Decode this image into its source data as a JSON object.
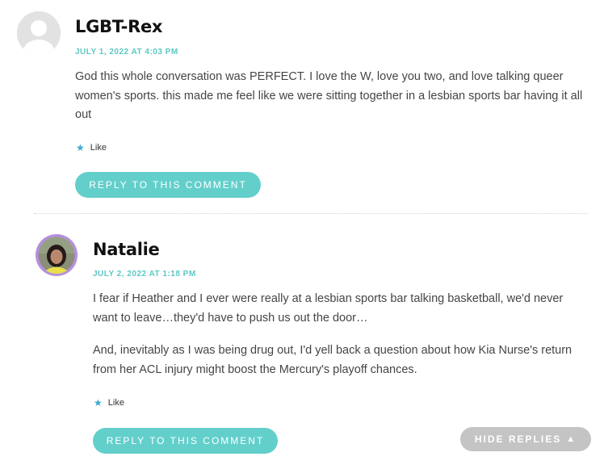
{
  "comments": [
    {
      "author": "LGBT-Rex",
      "date": "JULY 1, 2022 AT 4:03 PM",
      "paragraphs": [
        "God this whole conversation was PERFECT. I love the W, love you two, and love talking queer women's sports. this made me feel like we were sitting together in a lesbian sports bar having it all out"
      ],
      "like_label": "Like",
      "reply_label": "REPLY TO THIS COMMENT",
      "avatar_icon": "default-avatar-icon"
    },
    {
      "author": "Natalie",
      "date": "JULY 2, 2022 AT 1:18 PM",
      "paragraphs": [
        "I fear if Heather and I ever were really at a lesbian sports bar talking basketball, we'd never want to leave…they'd have to push us out the door…",
        "And, inevitably as I was being drug out, I'd yell back a question about how Kia Nurse's return from her ACL injury might boost the Mercury's playoff chances."
      ],
      "like_label": "Like",
      "reply_label": "REPLY TO THIS COMMENT",
      "avatar_icon": "user-photo-avatar"
    }
  ],
  "hide_replies_label": "HIDE REPLIES",
  "colors": {
    "accent": "#63cfcb",
    "date": "#5bc8c4",
    "hide_button": "#c4c4c4",
    "star": "#3aa9d0",
    "avatar_ring": "#b68fe0"
  }
}
